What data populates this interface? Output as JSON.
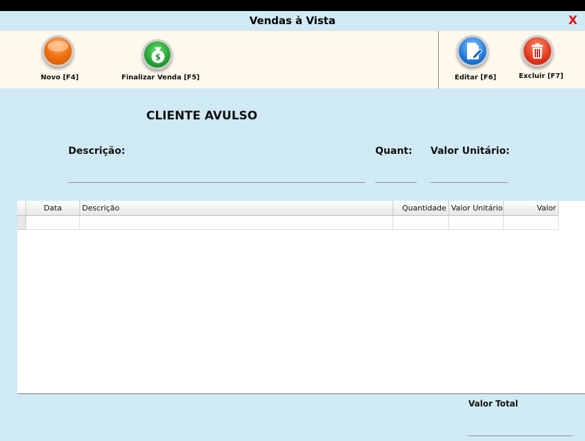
{
  "window": {
    "title": "Vendas à Vista",
    "close_label": "X"
  },
  "toolbar": {
    "novo_label": "Novo [F4]",
    "finalizar_label": "Finalizar Venda [F5]",
    "editar_label": "Editar [F6]",
    "excluir_label": "Excluir [F7]"
  },
  "colors": {
    "background": "#d0eaf5",
    "toolbar": "#fff8ec",
    "close": "#e01010"
  },
  "icons": {
    "novo": "orange-orb-icon",
    "finalizar": "money-bag-icon",
    "editar": "edit-document-icon",
    "excluir": "trash-icon"
  },
  "customer": {
    "name": "CLIENTE AVULSO"
  },
  "form": {
    "descricao_label": "Descrição:",
    "descricao_value": "",
    "quant_label": "Quant:",
    "quant_value": "",
    "valor_unitario_label": "Valor Unitário:",
    "valor_unitario_value": ""
  },
  "table": {
    "columns": [
      "Data",
      "Descrição",
      "Quantidade",
      "Valor Unitário",
      "Valor"
    ],
    "rows": [
      [
        "",
        "",
        "",
        "",
        ""
      ]
    ]
  },
  "totals": {
    "label": "Valor Total",
    "value": ""
  }
}
